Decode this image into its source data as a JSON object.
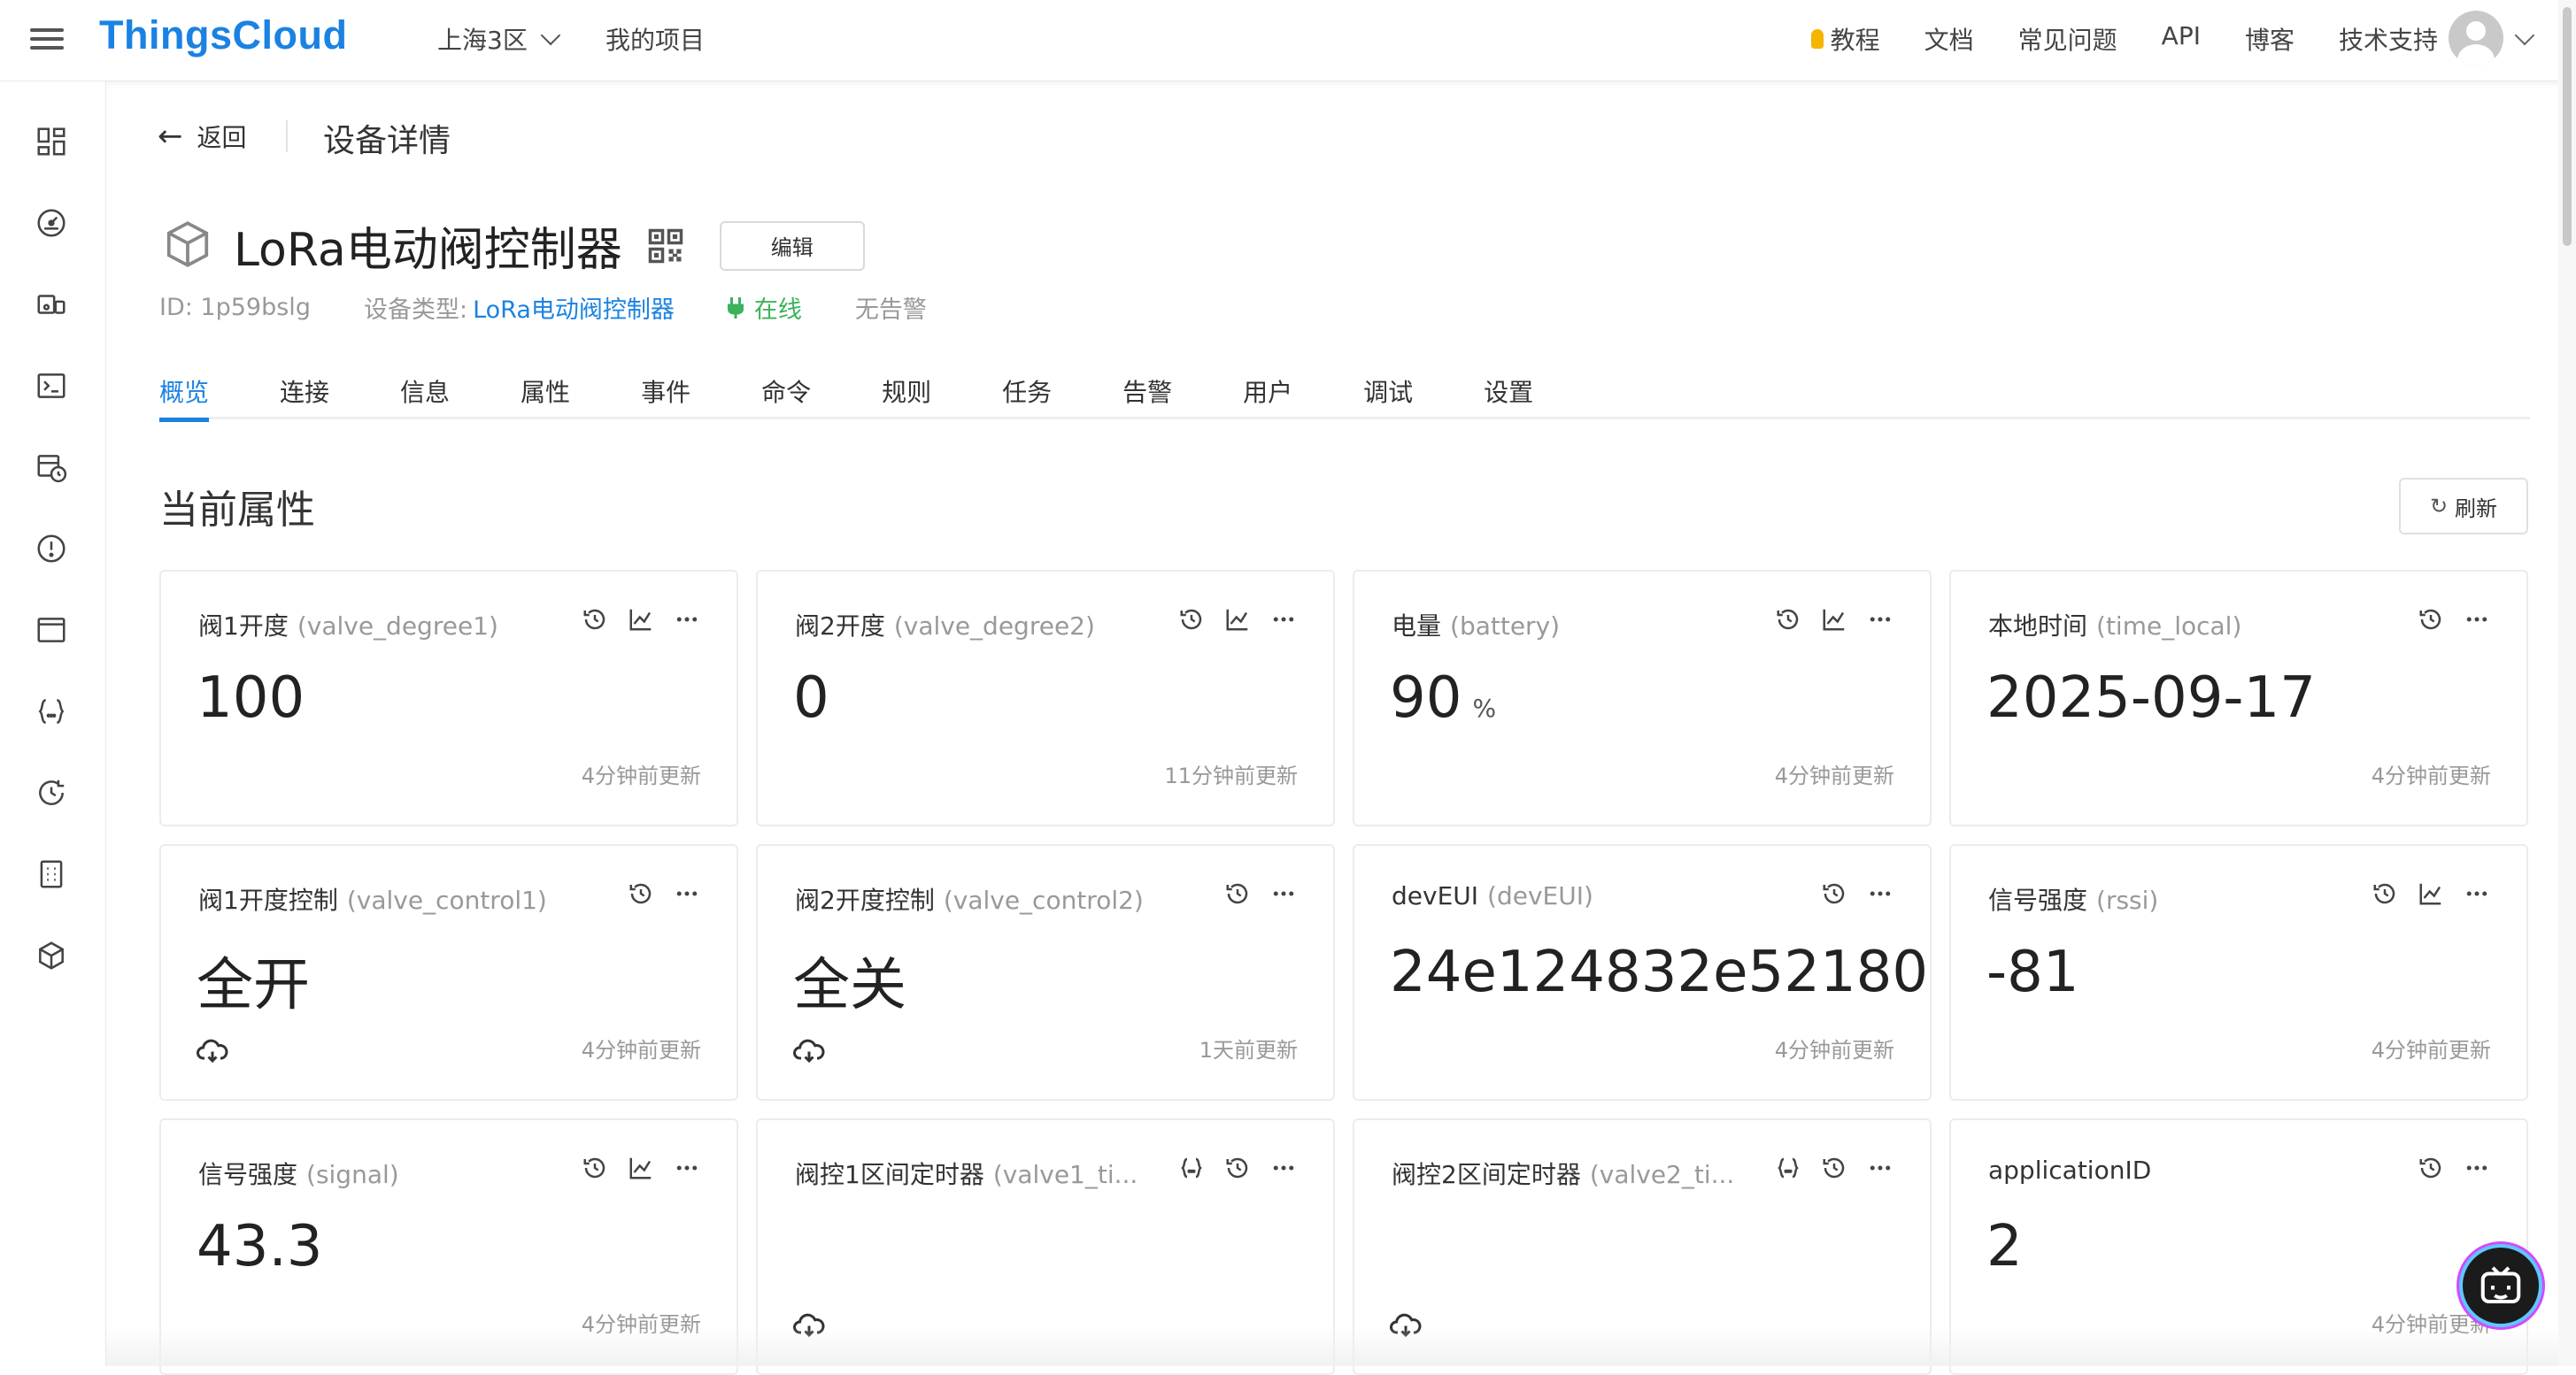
{
  "header": {
    "logo": "ThingsCloud",
    "region": "上海3区",
    "my_projects": "我的项目",
    "nav": {
      "tutorial": "教程",
      "docs": "文档",
      "faq": "常见问题",
      "api": "API",
      "blog": "博客",
      "support": "技术支持"
    }
  },
  "sidebar": {
    "icons": [
      "dashboard-icon",
      "gauge-icon",
      "devices-icon",
      "terminal-icon",
      "schedule-icon",
      "alert-icon",
      "window-icon",
      "braces-icon",
      "refresh-clock-icon",
      "building-icon",
      "package-icon"
    ]
  },
  "page": {
    "back_label": "返回",
    "title": "设备详情"
  },
  "device": {
    "name": "LoRa电动阀控制器",
    "edit_label": "编辑",
    "id_label": "ID: 1p59bslg",
    "type_prefix": "设备类型:",
    "type_name": "LoRa电动阀控制器",
    "status": "在线",
    "alarm": "无告警"
  },
  "tabs": [
    "概览",
    "连接",
    "信息",
    "属性",
    "事件",
    "命令",
    "规则",
    "任务",
    "告警",
    "用户",
    "调试",
    "设置"
  ],
  "section": {
    "title": "当前属性",
    "refresh_label": "刷新"
  },
  "cards": [
    {
      "name": "阀1开度",
      "id": "(valve_degree1)",
      "value": "100",
      "unit": "",
      "updated": "4分钟前更新",
      "actions": [
        "history",
        "chart",
        "more"
      ],
      "cloud": false
    },
    {
      "name": "阀2开度",
      "id": "(valve_degree2)",
      "value": "0",
      "unit": "",
      "updated": "11分钟前更新",
      "actions": [
        "history",
        "chart",
        "more"
      ],
      "cloud": false
    },
    {
      "name": "电量",
      "id": "(battery)",
      "value": "90",
      "unit": "%",
      "updated": "4分钟前更新",
      "actions": [
        "history",
        "chart",
        "more"
      ],
      "cloud": false
    },
    {
      "name": "本地时间",
      "id": "(time_local)",
      "value": "2025-09-17",
      "unit": "",
      "updated": "4分钟前更新",
      "actions": [
        "history",
        "more"
      ],
      "cloud": false
    },
    {
      "name": "阀1开度控制",
      "id": "(valve_control1)",
      "value": "全开",
      "unit": "",
      "updated": "4分钟前更新",
      "actions": [
        "history",
        "more"
      ],
      "cloud": true
    },
    {
      "name": "阀2开度控制",
      "id": "(valve_control2)",
      "value": "全关",
      "unit": "",
      "updated": "1天前更新",
      "actions": [
        "history",
        "more"
      ],
      "cloud": true
    },
    {
      "name": "devEUI",
      "id": "(devEUI)",
      "value": "24e124832e52180",
      "unit": "",
      "updated": "4分钟前更新",
      "actions": [
        "history",
        "more"
      ],
      "cloud": false
    },
    {
      "name": "信号强度",
      "id": "(rssi)",
      "value": "-81",
      "unit": "",
      "updated": "4分钟前更新",
      "actions": [
        "history",
        "chart",
        "more"
      ],
      "cloud": false
    },
    {
      "name": "信号强度",
      "id": "(signal)",
      "value": "43.3",
      "unit": "",
      "updated": "4分钟前更新",
      "actions": [
        "history",
        "chart",
        "more"
      ],
      "cloud": false
    },
    {
      "name": "阀控1区间定时器",
      "id": "(valve1_ti...",
      "value": "",
      "unit": "",
      "updated": "",
      "actions": [
        "braces",
        "history",
        "more"
      ],
      "cloud": true
    },
    {
      "name": "阀控2区间定时器",
      "id": "(valve2_ti...",
      "value": "",
      "unit": "",
      "updated": "",
      "actions": [
        "braces",
        "history",
        "more"
      ],
      "cloud": true
    },
    {
      "name": "applicationID",
      "id": "",
      "value": "2",
      "unit": "",
      "updated": "4分钟前更新",
      "actions": [
        "history",
        "more"
      ],
      "cloud": false
    }
  ],
  "colors": {
    "brand": "#1a82e2",
    "online": "#3cb35a",
    "muted": "#999999"
  }
}
